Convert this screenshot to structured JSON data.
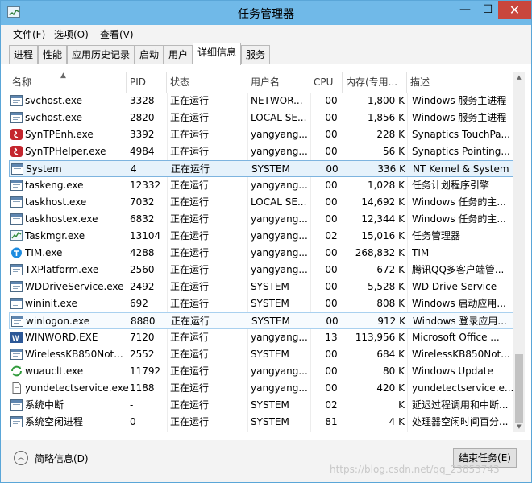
{
  "window": {
    "title": "任务管理器"
  },
  "menu": [
    "文件(F)",
    "选项(O)",
    "查看(V)"
  ],
  "tabs": [
    "进程",
    "性能",
    "应用历史记录",
    "启动",
    "用户",
    "详细信息",
    "服务"
  ],
  "active_tab": "详细信息",
  "columns": [
    "名称",
    "PID",
    "状态",
    "用户名",
    "CPU",
    "内存(专用...",
    "描述"
  ],
  "rows": [
    {
      "name": "svchost.exe",
      "pid": "3328",
      "status": "正在运行",
      "user": "NETWOR...",
      "cpu": "00",
      "mem": "1,800 K",
      "desc": "Windows 服务主进程",
      "icon": "service-window-icon"
    },
    {
      "name": "svchost.exe",
      "pid": "2820",
      "status": "正在运行",
      "user": "LOCAL SE...",
      "cpu": "00",
      "mem": "1,856 K",
      "desc": "Windows 服务主进程",
      "icon": "service-window-icon"
    },
    {
      "name": "SynTPEnh.exe",
      "pid": "3392",
      "status": "正在运行",
      "user": "yangyang...",
      "cpu": "00",
      "mem": "228 K",
      "desc": "Synaptics TouchPa...",
      "icon": "synaptics-icon"
    },
    {
      "name": "SynTPHelper.exe",
      "pid": "4984",
      "status": "正在运行",
      "user": "yangyang...",
      "cpu": "00",
      "mem": "56 K",
      "desc": "Synaptics Pointing...",
      "icon": "synaptics-icon"
    },
    {
      "name": "System",
      "pid": "4",
      "status": "正在运行",
      "user": "SYSTEM",
      "cpu": "00",
      "mem": "336 K",
      "desc": "NT Kernel & System",
      "icon": "service-window-icon",
      "selected": true
    },
    {
      "name": "taskeng.exe",
      "pid": "12332",
      "status": "正在运行",
      "user": "yangyang...",
      "cpu": "00",
      "mem": "1,028 K",
      "desc": "任务计划程序引擎",
      "icon": "service-window-icon"
    },
    {
      "name": "taskhost.exe",
      "pid": "7032",
      "status": "正在运行",
      "user": "LOCAL SE...",
      "cpu": "00",
      "mem": "14,692 K",
      "desc": "Windows 任务的主...",
      "icon": "service-window-icon"
    },
    {
      "name": "taskhostex.exe",
      "pid": "6832",
      "status": "正在运行",
      "user": "yangyang...",
      "cpu": "00",
      "mem": "12,344 K",
      "desc": "Windows 任务的主...",
      "icon": "service-window-icon"
    },
    {
      "name": "Taskmgr.exe",
      "pid": "13104",
      "status": "正在运行",
      "user": "yangyang...",
      "cpu": "02",
      "mem": "15,016 K",
      "desc": "任务管理器",
      "icon": "task-manager-icon"
    },
    {
      "name": "TIM.exe",
      "pid": "4288",
      "status": "正在运行",
      "user": "yangyang...",
      "cpu": "00",
      "mem": "268,832 K",
      "desc": "TIM",
      "icon": "tim-icon"
    },
    {
      "name": "TXPlatform.exe",
      "pid": "2560",
      "status": "正在运行",
      "user": "yangyang...",
      "cpu": "00",
      "mem": "672 K",
      "desc": "腾讯QQ多客户端管...",
      "icon": "service-window-icon"
    },
    {
      "name": "WDDriveService.exe",
      "pid": "2492",
      "status": "正在运行",
      "user": "SYSTEM",
      "cpu": "00",
      "mem": "5,528 K",
      "desc": "WD Drive Service",
      "icon": "service-window-icon"
    },
    {
      "name": "wininit.exe",
      "pid": "692",
      "status": "正在运行",
      "user": "SYSTEM",
      "cpu": "00",
      "mem": "808 K",
      "desc": "Windows 启动应用...",
      "icon": "service-window-icon"
    },
    {
      "name": "winlogon.exe",
      "pid": "8880",
      "status": "正在运行",
      "user": "SYSTEM",
      "cpu": "00",
      "mem": "912 K",
      "desc": "Windows 登录应用...",
      "icon": "service-window-icon",
      "hover": true
    },
    {
      "name": "WINWORD.EXE",
      "pid": "7120",
      "status": "正在运行",
      "user": "yangyang...",
      "cpu": "13",
      "mem": "113,956 K",
      "desc": "Microsoft Office ...",
      "icon": "word-icon"
    },
    {
      "name": "WirelessKB850Not...",
      "pid": "2552",
      "status": "正在运行",
      "user": "SYSTEM",
      "cpu": "00",
      "mem": "684 K",
      "desc": "WirelessKB850Not...",
      "icon": "service-window-icon"
    },
    {
      "name": "wuauclt.exe",
      "pid": "11792",
      "status": "正在运行",
      "user": "yangyang...",
      "cpu": "00",
      "mem": "80 K",
      "desc": "Windows Update",
      "icon": "windows-update-icon"
    },
    {
      "name": "yundetectservice.exe",
      "pid": "1188",
      "status": "正在运行",
      "user": "yangyang...",
      "cpu": "00",
      "mem": "420 K",
      "desc": "yundetectservice.e...",
      "icon": "document-icon"
    },
    {
      "name": "系统中断",
      "pid": "-",
      "status": "正在运行",
      "user": "SYSTEM",
      "cpu": "02",
      "mem": "K",
      "desc": "延迟过程调用和中断...",
      "icon": "service-window-icon"
    },
    {
      "name": "系统空闲进程",
      "pid": "0",
      "status": "正在运行",
      "user": "SYSTEM",
      "cpu": "81",
      "mem": "4 K",
      "desc": "处理器空闲时间百分...",
      "icon": "service-window-icon"
    }
  ],
  "footer": {
    "fewer_details": "简略信息(D)",
    "end_task": "结束任务(E)"
  },
  "watermark": "https://blog.csdn.net/qq_23853743",
  "colors": {
    "titlebar": "#70b9e8",
    "close": "#c9463d",
    "selection": "#e6f2fb"
  }
}
